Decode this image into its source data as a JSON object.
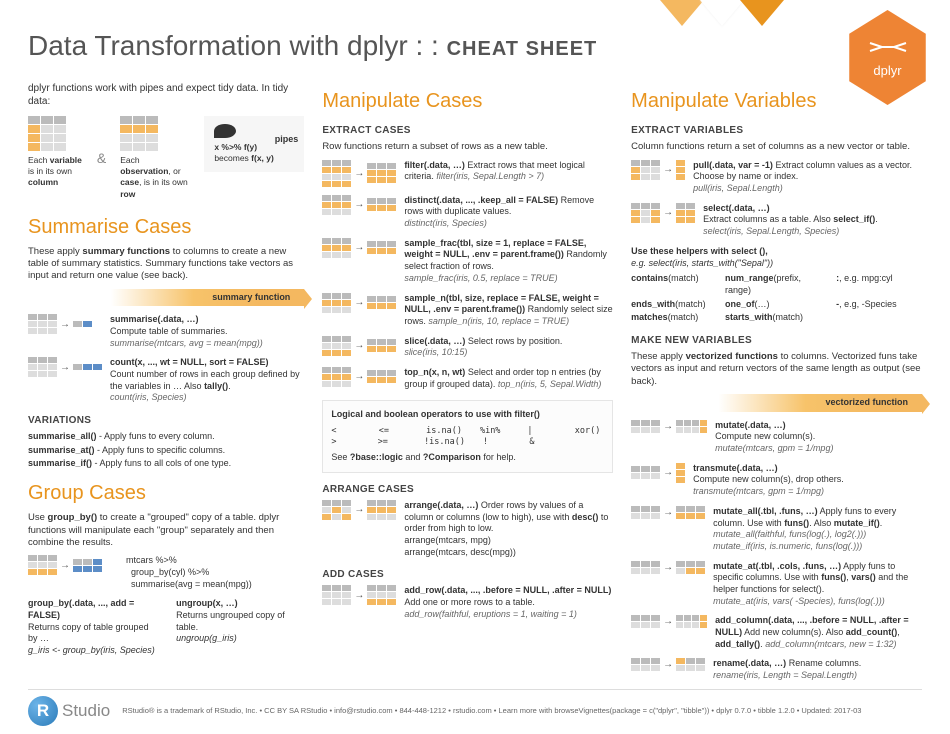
{
  "title_main": "Data Transformation with dplyr : : ",
  "title_bold": "CHEAT SHEET",
  "hex_label": "dplyr",
  "intro": "dplyr functions work with pipes and expect tidy data. In tidy data:",
  "tidy_col": "Each variable is in its own column",
  "tidy_row": "Each observation, or case, is in its own row",
  "pipes_label": "pipes",
  "pipes_text": "x %>% f(y) becomes f(x, y)",
  "h2_summarise": "Summarise Cases",
  "summ_desc": "These apply summary functions to columns to create a new table of summary statistics. Summary functions take vectors as input and return one value (see back).",
  "banner_summary": "summary function",
  "summarise_sig": "summarise(.data, …)",
  "summarise_desc": "Compute table of summaries.",
  "summarise_ex": "summarise(mtcars, avg = mean(mpg))",
  "count_sig": "count(x, ..., wt = NULL, sort = FALSE)",
  "count_desc": "Count number of rows in each group defined by the variables in … Also tally().",
  "count_ex": "count(iris, Species)",
  "variations_h": "VARIATIONS",
  "var_all": "summarise_all() - Apply funs to every column.",
  "var_at": "summarise_at() - Apply funs to specific columns.",
  "var_if": "summarise_if() - Apply funs to all cols of one type.",
  "h2_group": "Group Cases",
  "group_desc": "Use group_by() to create a \"grouped\" copy of a table. dplyr functions will manipulate each \"group\" separately and then combine the results.",
  "group_code1": "mtcars %>%",
  "group_code2": "group_by(cyl) %>%",
  "group_code3": "summarise(avg = mean(mpg))",
  "groupby_sig": "group_by(.data, ..., add = FALSE)",
  "groupby_desc": "Returns copy of table grouped by …",
  "groupby_ex": "g_iris <- group_by(iris, Species)",
  "ungroup_sig": "ungroup(x, …)",
  "ungroup_desc": "Returns ungrouped copy of table.",
  "ungroup_ex": "ungroup(g_iris)",
  "h2_cases": "Manipulate Cases",
  "extract_cases_h": "EXTRACT CASES",
  "extract_cases_desc": "Row functions return a subset of rows as a new table.",
  "filter_sig": "filter(.data, …)",
  "filter_desc": " Extract rows that meet logical criteria. ",
  "filter_ex": "filter(iris, Sepal.Length > 7)",
  "distinct_sig": "distinct(.data, ..., .keep_all = FALSE)",
  "distinct_desc": " Remove rows with duplicate values.",
  "distinct_ex": "distinct(iris, Species)",
  "samplefrac_sig": "sample_frac(tbl, size = 1, replace = FALSE, weight = NULL, .env = parent.frame())",
  "samplefrac_desc": " Randomly select fraction of rows.",
  "samplefrac_ex": "sample_frac(iris, 0.5, replace = TRUE)",
  "samplen_sig": "sample_n(tbl, size, replace = FALSE, weight = NULL, .env = parent.frame())",
  "samplen_desc": " Randomly select size rows. ",
  "samplen_ex": "sample_n(iris, 10, replace = TRUE)",
  "slice_sig": "slice(.data, …)",
  "slice_desc": " Select rows by position.",
  "slice_ex": "slice(iris, 10:15)",
  "topn_sig": "top_n(x, n, wt)",
  "topn_desc": " Select and order top n entries (by group if grouped data). ",
  "topn_ex": "top_n(iris, 5, Sepal.Width)",
  "logic_h": "Logical and boolean operators to use with filter()",
  "logic_r1": "<    <=    is.na()    %in%    |    xor()",
  "logic_r2": ">    >=    !is.na()    !    &",
  "logic_help": "See ?base::logic and ?Comparison for help.",
  "arrange_h": "ARRANGE CASES",
  "arrange_sig": "arrange(.data, …)",
  "arrange_desc": " Order rows by values of a column or columns (low to high), use with desc() to order from high to low.",
  "arrange_ex1": "arrange(mtcars, mpg)",
  "arrange_ex2": "arrange(mtcars, desc(mpg))",
  "addcases_h": "ADD CASES",
  "addrow_sig": "add_row(.data, ..., .before = NULL, .after = NULL)",
  "addrow_desc": " Add one or more rows to a table.",
  "addrow_ex": "add_row(faithful, eruptions = 1, waiting = 1)",
  "h2_vars": "Manipulate Variables",
  "extract_vars_h": "EXTRACT VARIABLES",
  "extract_vars_desc": "Column functions return a set of columns as a new vector or table.",
  "pull_sig": "pull(.data, var = -1)",
  "pull_desc": " Extract column values as a vector. Choose by name or index.",
  "pull_ex": "pull(iris, Sepal.Length)",
  "select_sig": "select(.data, …)",
  "select_desc": "Extract columns as a table. Also select_if().",
  "select_ex": "select(iris, Sepal.Length, Species)",
  "helpers_intro": "Use these helpers with select (),",
  "helpers_ex": "e.g. select(iris, starts_with(\"Sepal\"))",
  "helper_contains": "contains(match)",
  "helper_numrange": "num_range(prefix, range)",
  "helper_colon1": ":, e.g. mpg:cyl",
  "helper_endswith": "ends_with(match)",
  "helper_oneof": "one_of(…)",
  "helper_colon2": "-, e.g, -Species",
  "helper_matches": "matches(match)",
  "helper_startswith": "starts_with(match)",
  "makenew_h": "MAKE NEW VARIABLES",
  "makenew_desc": "These apply vectorized functions to columns. Vectorized funs take vectors as input and return vectors of the same length as output (see back).",
  "banner_vec": "vectorized function",
  "mutate_sig": "mutate(.data, …)",
  "mutate_desc": "Compute new column(s).",
  "mutate_ex": "mutate(mtcars, gpm = 1/mpg)",
  "transmute_sig": "transmute(.data, …)",
  "transmute_desc": "Compute new column(s), drop others.",
  "transmute_ex": "transmute(mtcars, gpm = 1/mpg)",
  "mutateall_sig": "mutate_all(.tbl, .funs, …)",
  "mutateall_desc": " Apply funs to every column. Use with funs(). Also mutate_if().",
  "mutateall_ex1": "mutate_all(faithful, funs(log(.), log2(.)))",
  "mutateall_ex2": "mutate_if(iris, is.numeric, funs(log(.)))",
  "mutateat_sig": "mutate_at(.tbl, .cols, .funs, …)",
  "mutateat_desc": " Apply funs to specific columns. Use with funs(), vars() and the helper functions for select().",
  "mutateat_ex": "mutate_at(iris, vars( -Species), funs(log(.)))",
  "addcol_sig": "add_column(.data, ..., .before = NULL, .after = NULL)",
  "addcol_desc": " Add new column(s). Also add_count(), add_tally(). ",
  "addcol_ex": "add_column(mtcars, new = 1:32)",
  "rename_sig": "rename(.data, …)",
  "rename_desc": " Rename columns.",
  "rename_ex": "rename(iris, Length = Sepal.Length)",
  "footer_text": "RStudio® is a trademark of RStudio, Inc. • CC BY SA RStudio • info@rstudio.com • 844-448-1212 • rstudio.com • Learn more with browseVignettes(package = c(\"dplyr\", \"tibble\")) • dplyr 0.7.0 • tibble 1.2.0 • Updated: 2017-03",
  "rstudio_r": "R",
  "rstudio_studio": "Studio"
}
